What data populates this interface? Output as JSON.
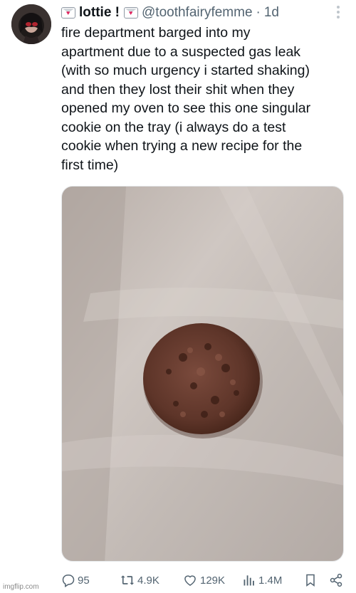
{
  "tweet": {
    "display_name": "lottie !",
    "handle": "@toothfairyfemme",
    "separator": "·",
    "time_ago": "1d",
    "text": "fire department barged into my\napartment due to a suspected gas leak\n(with so much urgency i started shaking)\nand then they lost their shit when they\nopened my oven to see this one singular\ncookie on the tray (i always do a test\ncookie when trying a new recipe for the\nfirst time)"
  },
  "icons": {
    "name_badge": "love-letter-icon",
    "more": "more-options-icon"
  },
  "actions": {
    "replies": "95",
    "reposts": "4.9K",
    "likes": "129K",
    "views": "1.4M"
  },
  "watermark": "imgflip.com",
  "colors": {
    "text": "#0f1419",
    "muted": "#536471",
    "heart": "#e0245e"
  }
}
